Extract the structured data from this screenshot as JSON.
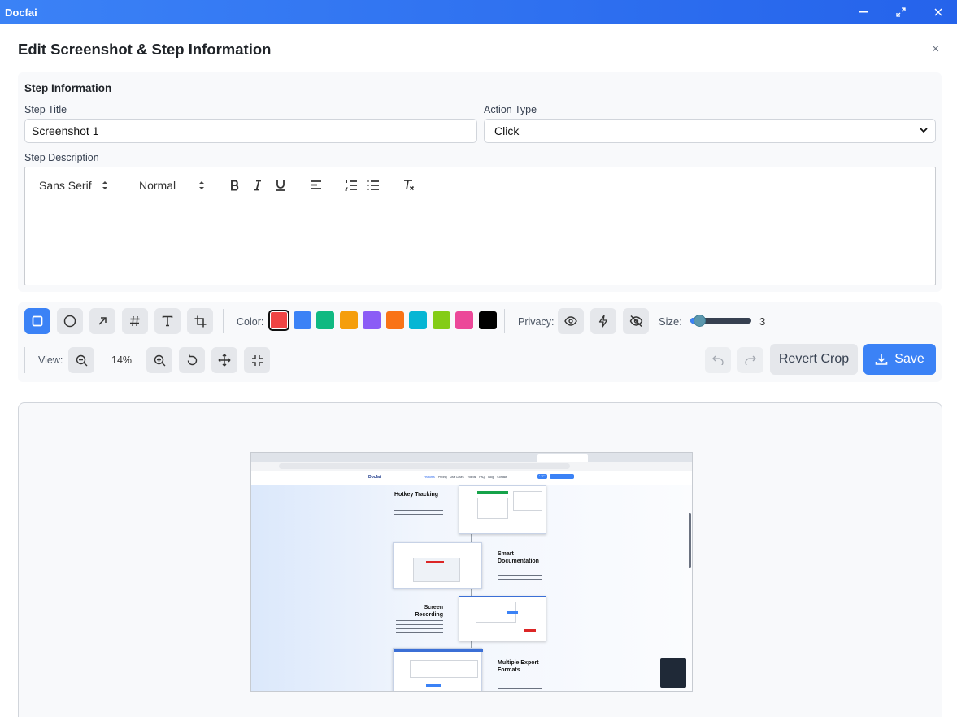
{
  "app": {
    "name": "Docfai"
  },
  "dialog": {
    "title": "Edit Screenshot & Step Information"
  },
  "step": {
    "section_title": "Step Information",
    "title_label": "Step Title",
    "title_value": "Screenshot 1",
    "action_label": "Action Type",
    "action_value": "Click",
    "description_label": "Step Description"
  },
  "editor_toolbar": {
    "font": "Sans Serif",
    "size": "Normal"
  },
  "tools": {
    "color_label": "Color:",
    "colors": [
      "#ef4444",
      "#3b82f6",
      "#10b981",
      "#f59e0b",
      "#8b5cf6",
      "#f97316",
      "#06b6d4",
      "#84cc16",
      "#ec4899",
      "#000000"
    ],
    "privacy_label": "Privacy:",
    "size_label": "Size:",
    "size_value": "3",
    "size_fraction": 0.15,
    "view_label": "View:",
    "zoom_value": "14%",
    "revert_label": "Revert Crop",
    "save_label": "Save"
  },
  "screenshot": {
    "nav_links": [
      "Features",
      "Pricing",
      "Use Cases",
      "Videos",
      "FAQ",
      "Blog",
      "Contact"
    ],
    "headings": [
      "Hotkey Tracking",
      "Smart Documentation",
      "Screen Recording",
      "Multiple Export Formats"
    ],
    "brand": "Docfai",
    "login": "Login"
  }
}
